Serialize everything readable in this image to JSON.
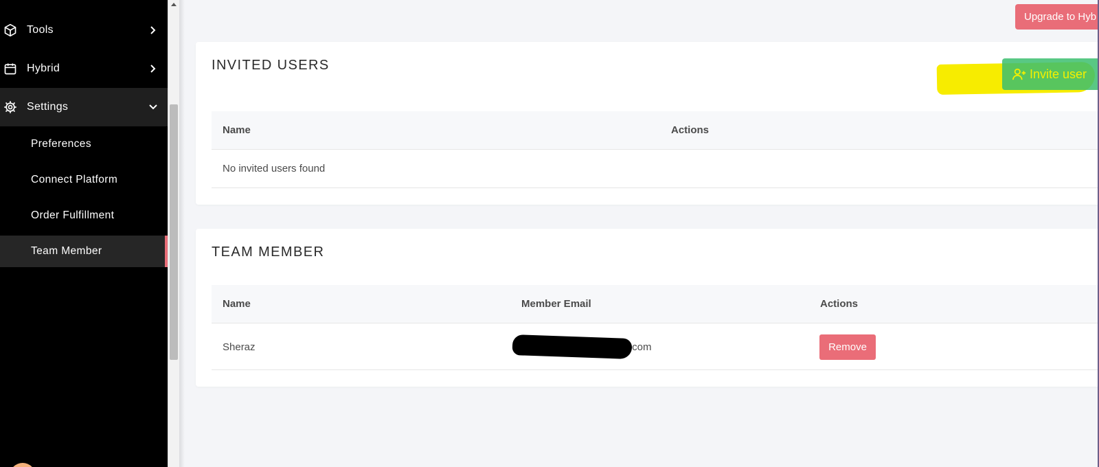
{
  "sidebar": {
    "items": [
      {
        "label": "Tools",
        "icon": "cube-icon"
      },
      {
        "label": "Hybrid",
        "icon": "calendar-icon"
      },
      {
        "label": "Settings",
        "icon": "gear-icon"
      }
    ],
    "settings_subitems": [
      {
        "label": "Preferences"
      },
      {
        "label": "Connect Platform"
      },
      {
        "label": "Order Fulfillment"
      },
      {
        "label": "Team Member"
      }
    ],
    "current_item": "Team Member"
  },
  "header": {
    "upgrade_label": "Upgrade to Hyb"
  },
  "invited_users": {
    "title": "INVITED USERS",
    "invite_label": "Invite user",
    "columns": [
      "Name",
      "Actions"
    ],
    "empty_text": "No invited users found"
  },
  "team_member": {
    "title": "TEAM MEMBER",
    "columns": [
      "Name",
      "Member Email",
      "Actions"
    ],
    "rows": [
      {
        "name": "Sheraz",
        "email_visible_suffix": ".com",
        "action_label": "Remove"
      }
    ]
  },
  "colors": {
    "accent_red": "#e96d78",
    "invite_green": "#3cbe6e",
    "highlight_yellow": "#f7ec00",
    "sidebar_bg": "#000000"
  }
}
